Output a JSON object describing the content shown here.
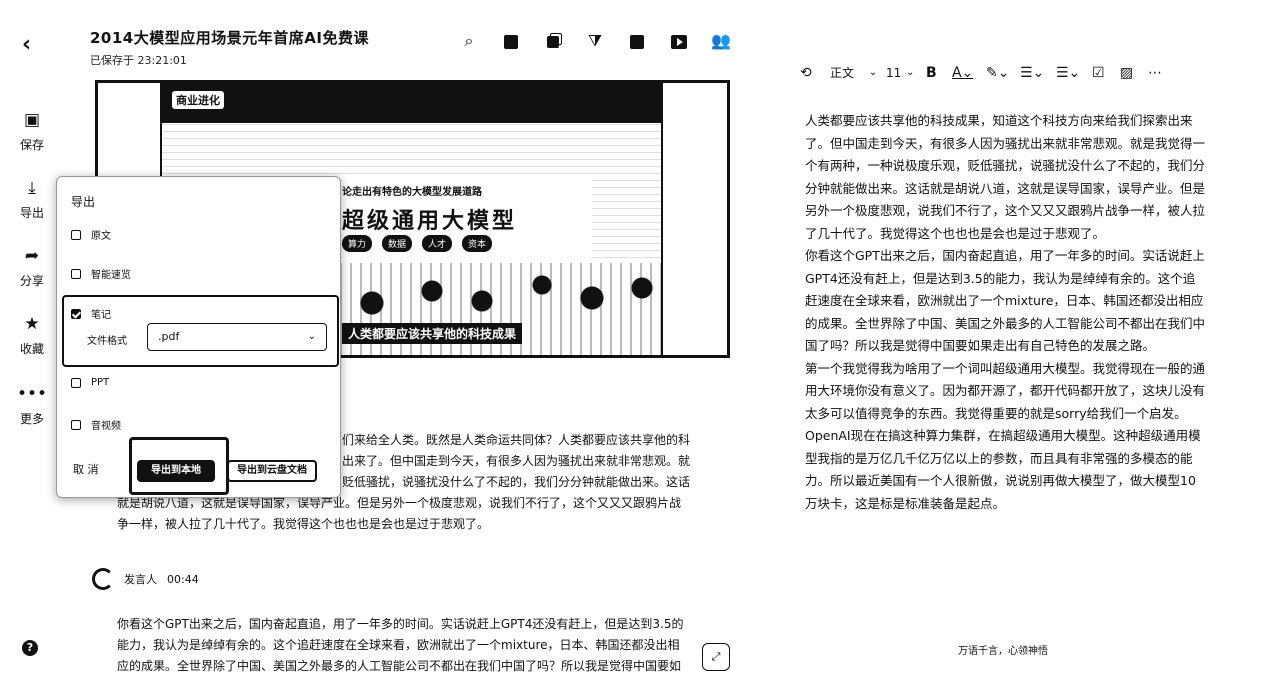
{
  "header": {
    "title": "2014大模型应用场景元年首席AI免费课",
    "saved": "已保存于 23:21:01"
  },
  "rail": {
    "items": [
      {
        "label": "保存",
        "icon": "save-icon"
      },
      {
        "label": "导出",
        "icon": "export-icon"
      },
      {
        "label": "分享",
        "icon": "share-icon"
      },
      {
        "label": "收藏",
        "icon": "star-icon"
      },
      {
        "label": "更多",
        "icon": "more-icon"
      }
    ],
    "help": "?"
  },
  "video": {
    "ceiling_tag": "商业进化",
    "screen_top": "论走出有特色的大模型发展道路",
    "big_title": "超级通用大模型",
    "tags": [
      "算力",
      "数据",
      "人才",
      "资本"
    ],
    "subtitle": "人类都要应该共享他的科技成果"
  },
  "export": {
    "title": "导出",
    "options": [
      {
        "label": "原文",
        "checked": false
      },
      {
        "label": "智能速览",
        "checked": false
      },
      {
        "label": "笔记",
        "checked": true
      },
      {
        "label": "PPT",
        "checked": false
      },
      {
        "label": "音视频",
        "checked": false
      }
    ],
    "format_label": "文件格式",
    "format_value": ".pdf",
    "cancel": "取 消",
    "primary": "导出到本地",
    "secondary": "导出到云盘文档"
  },
  "transcript": {
    "p1_l1": "们来给全人类。既然是人类命运共同体？人类都要应该共享他的科",
    "p1_l2": "出来了。但中国走到今天，有很多人因为骚扰出来就非常悲观。就",
    "p1_l3": "贬低骚扰，说骚扰没什么了不起的，我们分分钟就能做出来。这话",
    "p1_l4": "就是胡说八道，这就是误导国家，误导产业。但是另外一个极度悲观，说我们不行了，这个又又又跟鸦片战",
    "p1_l5": "争一样，被人拉了几十代了。我觉得这个也也也是会也是过于悲观了。",
    "speaker": "发言人",
    "time": "00:44",
    "p2_l1": "你看这个GPT出来之后，国内奋起直追，用了一年多的时间。实话说赶上GPT4还没有赶上，但是达到3.5的",
    "p2_l2": "能力，我认为是绰绰有余的。这个追赶速度在全球来看，欧洲就出了一个mixture，日本、韩国还都没出相",
    "p2_l3": "应的成果。全世界除了中国、美国之外最多的人工智能公司不都出在我们中国了吗？所以我是觉得中国要如"
  },
  "editor": {
    "style": "正文",
    "size": "11",
    "paragraphs": [
      "人类都要应该共享他的科技成果，知道这个科技方向来给我们探索出来了。但中国走到今天，有很多人因为骚扰出来就非常悲观。就是我觉得一个有两种，一种说极度乐观，贬低骚扰，说骚扰没什么了不起的，我们分分钟就能做出来。这话就是胡说八道，这就是误导国家，误导产业。但是另外一个极度悲观，说我们不行了，这个又又又跟鸦片战争一样，被人拉了几十代了。我觉得这个也也也是会也是过于悲观了。",
      "你看这个GPT出来之后，国内奋起直追，用了一年多的时间。实话说赶上GPT4还没有赶上，但是达到3.5的能力，我认为是绰绰有余的。这个追赶速度在全球来看，欧洲就出了一个mixture，日本、韩国还都没出相应的成果。全世界除了中国、美国之外最多的人工智能公司不都出在我们中国了吗？所以我是觉得中国要如果走出有自己特色的发展之路。",
      "第一个我觉得我为啥用了一个词叫超级通用大模型。我觉得现在一般的通用大环境你没有意义了。因为都开源了，都开代码都开放了，这块儿没有太多可以值得竞争的东西。我觉得重要的就是sorry给我们一个启发。OpenAI现在在搞这种算力集群，在搞超级通用大模型。这种超级通用模型我指的是万亿几千亿万亿以上的参数，而且具有非常强的多模态的能力。所以最近美国有一个人很新傲，说说别再做大模型了，做大模型10万块卡，这是标是标准装备是起点。"
    ],
    "footer": "万语千言，心领神悟"
  }
}
